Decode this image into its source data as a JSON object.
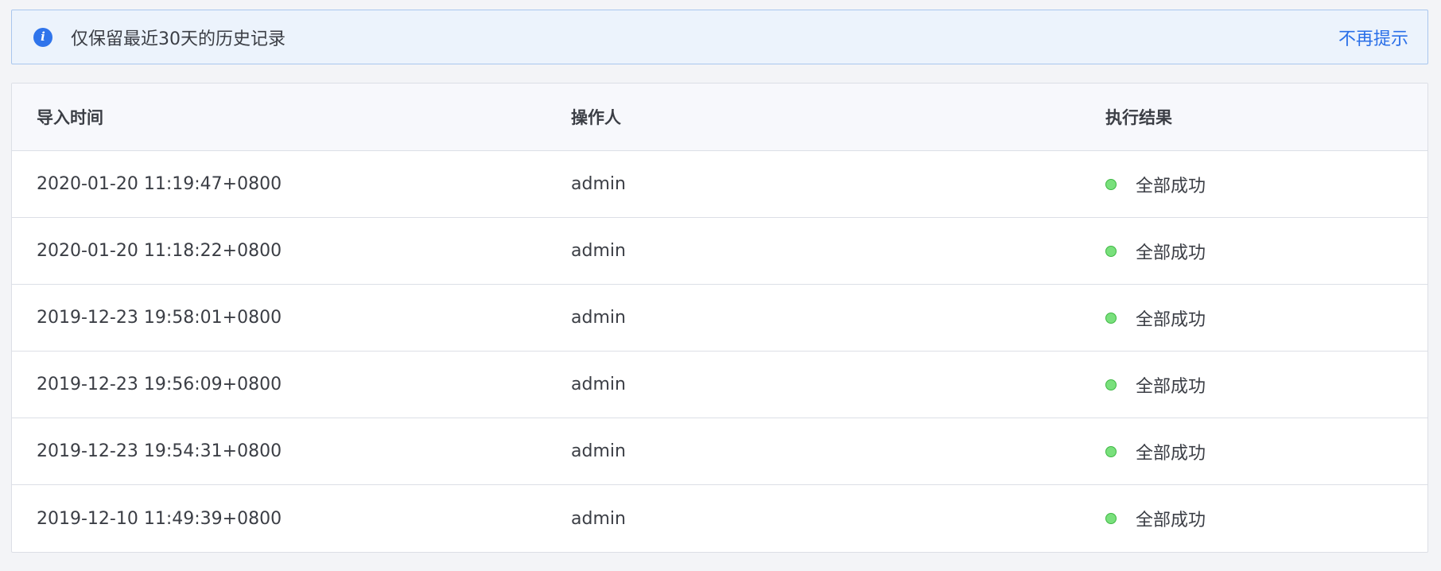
{
  "notice": {
    "icon": "info-icon",
    "text": "仅保留最近30天的历史记录",
    "dismiss_label": "不再提示",
    "accent": "#2f74eb"
  },
  "table": {
    "columns": {
      "time": "导入时间",
      "operator": "操作人",
      "result": "执行结果"
    },
    "status_color": "#79e07c",
    "rows": [
      {
        "time": "2020-01-20 11:19:47+0800",
        "operator": "admin",
        "result": "全部成功"
      },
      {
        "time": "2020-01-20 11:18:22+0800",
        "operator": "admin",
        "result": "全部成功"
      },
      {
        "time": "2019-12-23 19:58:01+0800",
        "operator": "admin",
        "result": "全部成功"
      },
      {
        "time": "2019-12-23 19:56:09+0800",
        "operator": "admin",
        "result": "全部成功"
      },
      {
        "time": "2019-12-23 19:54:31+0800",
        "operator": "admin",
        "result": "全部成功"
      },
      {
        "time": "2019-12-10 11:49:39+0800",
        "operator": "admin",
        "result": "全部成功"
      }
    ]
  }
}
